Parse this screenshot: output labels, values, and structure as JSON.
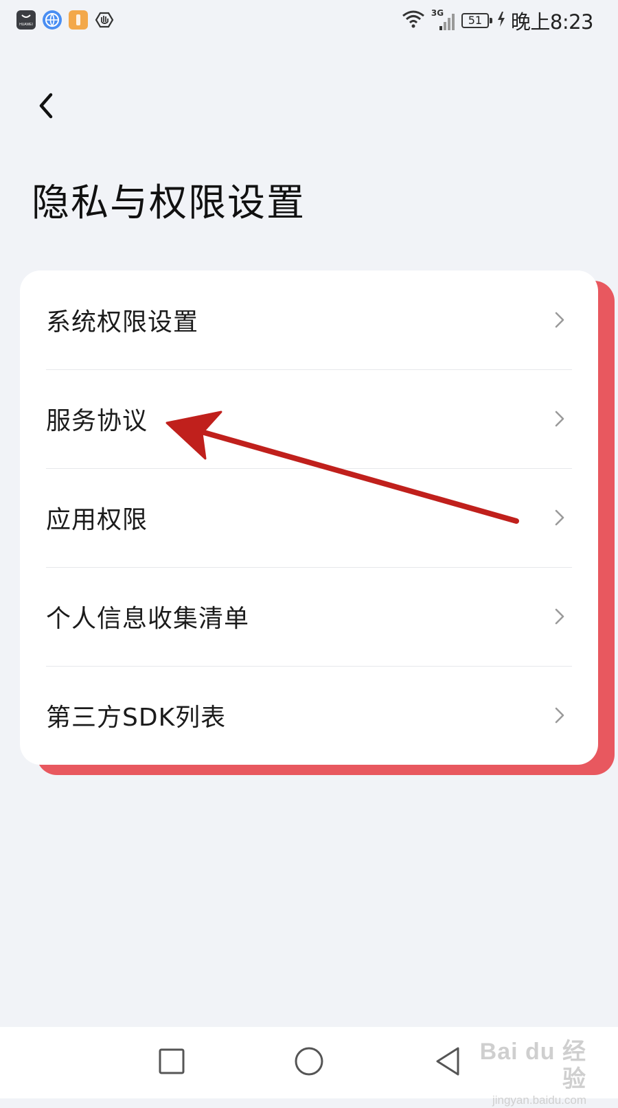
{
  "status_bar": {
    "app_icons": [
      "huawei-app-icon",
      "browser-app-icon",
      "wallet-app-icon",
      "card-app-icon",
      "shield-app-icon"
    ],
    "huawei_icon_text": "HUAWEI",
    "network_type": "3G",
    "battery_level": "51",
    "time": "晚上8:23"
  },
  "header": {
    "back_icon": "chevron-left-icon",
    "title": "隐私与权限设置"
  },
  "settings_list": {
    "items": [
      {
        "label": "系统权限设置",
        "icon": "chevron-right-icon"
      },
      {
        "label": "服务协议",
        "icon": "chevron-right-icon"
      },
      {
        "label": "应用权限",
        "icon": "chevron-right-icon"
      },
      {
        "label": "个人信息收集清单",
        "icon": "chevron-right-icon"
      },
      {
        "label": "第三方SDK列表",
        "icon": "chevron-right-icon"
      }
    ]
  },
  "annotation": {
    "color": "#c0201c",
    "points_to": "服务协议"
  },
  "nav_bar": {
    "buttons": [
      "recent-apps-icon",
      "home-icon",
      "back-triangle-icon"
    ]
  },
  "watermark": {
    "logo": "Bai du 经验",
    "url": "jingyan.baidu.com"
  },
  "colors": {
    "background": "#f1f3f7",
    "card": "#ffffff",
    "text": "#1b1b1b",
    "chevron": "#9a9a9a",
    "arrow": "#c0201c"
  }
}
